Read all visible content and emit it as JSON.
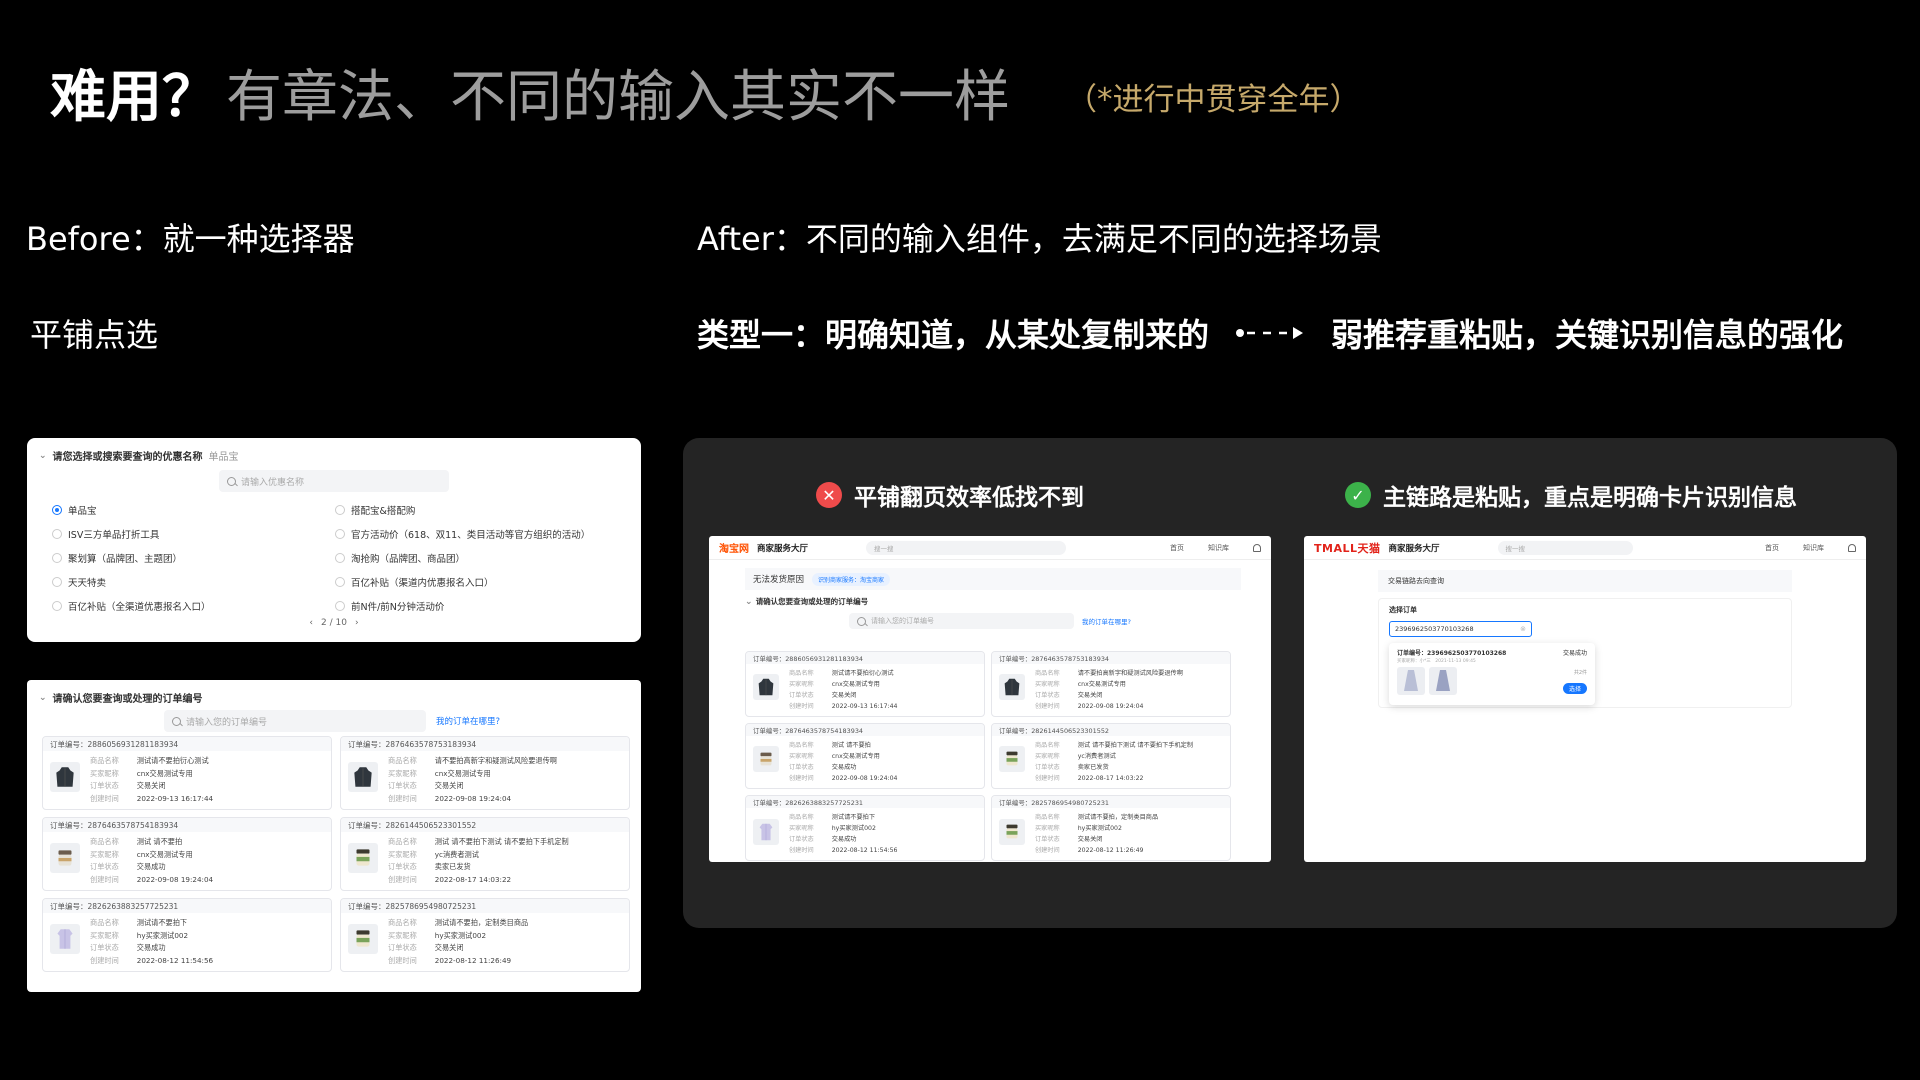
{
  "slide": {
    "title_strong": "难用？",
    "title_soft": "有章法、不同的输入其实不一样",
    "title_note": "（*进行中贯穿全年）",
    "before_heading": "Before：就一种选择器",
    "after_heading": "After：不同的输入组件，去满足不同的选择场景",
    "left_subheading": "平铺点选",
    "type_heading": "类型一：明确知道，从某处复制来的",
    "type_result": "弱推荐重粘贴，关键识别信息的强化"
  },
  "promo_panel": {
    "section_title": "请您选择或搜索要查询的优惠名称",
    "selected_value": "单品宝",
    "search_placeholder": "请输入优惠名称",
    "options": [
      {
        "label": "单品宝",
        "selected": true
      },
      {
        "label": "搭配宝&搭配购",
        "selected": false
      },
      {
        "label": "ISV三方单品打折工具",
        "selected": false
      },
      {
        "label": "官方活动价（618、双11、类目活动等官方组织的活动）",
        "selected": false
      },
      {
        "label": "聚划算（品牌团、主题团）",
        "selected": false
      },
      {
        "label": "淘抢购（品牌团、商品团）",
        "selected": false
      },
      {
        "label": "天天特卖",
        "selected": false
      },
      {
        "label": "百亿补贴（渠道内优惠报名入口）",
        "selected": false
      },
      {
        "label": "百亿补贴（全渠道优惠报名入口）",
        "selected": false
      },
      {
        "label": "前N件/前N分钟活动价",
        "selected": false
      }
    ],
    "pager": "2 / 10"
  },
  "order_panel": {
    "section_title": "请确认您要查询或处理的订单编号",
    "search_placeholder": "请输入您的订单编号",
    "help_link": "我的订单在哪里?",
    "field_labels": [
      "商品名称",
      "买家昵称",
      "订单状态",
      "创建时间"
    ],
    "orders": [
      {
        "id": "订单编号：2886056931281183934",
        "name": "测试请不要拍衍心测试",
        "buyer": "cnx交易测试专用",
        "status": "交易关闭",
        "time": "2022-09-13 16:17:44",
        "thumb": "jacket-dark"
      },
      {
        "id": "订单编号：2876463578753183934",
        "name": "请不要拍高新字和疑测试风险要退传啊",
        "buyer": "cnx交易测试专用",
        "status": "交易关闭",
        "time": "2022-09-08 19:24:04",
        "thumb": "jacket-dark"
      },
      {
        "id": "订单编号：2876463578754183934",
        "name": "测试 请不要拍",
        "buyer": "cnx交易测试专用",
        "status": "交易成功",
        "time": "2022-09-08 19:24:04",
        "thumb": "jar"
      },
      {
        "id": "订单编号：2826144506523301552",
        "name": "测试 请不要拍下测试 请不要拍下手机定制",
        "buyer": "yc消费者测试",
        "status": "卖家已发货",
        "time": "2022-08-17 14:03:22",
        "thumb": "jar-green"
      },
      {
        "id": "订单编号：2826263883257725231",
        "name": "测试请不要拍下",
        "buyer": "hy买家测试002",
        "status": "交易成功",
        "time": "2022-08-12 11:54:56",
        "thumb": "clothes-purple"
      },
      {
        "id": "订单编号：2825786954980725231",
        "name": "测试请不要拍，定制类目商品",
        "buyer": "hy买家测试002",
        "status": "交易关闭",
        "time": "2022-08-12 11:26:49",
        "thumb": "jar-green"
      }
    ]
  },
  "comparison": {
    "bad_label": "平铺翻页效率低找不到",
    "good_label": "主链路是粘贴，重点是明确卡片识别信息",
    "taobao": {
      "logo": "淘宝网",
      "hall": "商家服务大厅",
      "search_placeholder": "搜一搜",
      "nav": [
        "首页",
        "知识库"
      ],
      "scene_title": "无法发货原因",
      "scene_tag": "识别商家服务：淘宝商家",
      "section_title": "请确认您要查询或处理的订单编号",
      "search_placeholder_2": "请输入您的订单编号",
      "help_link": "我的订单在哪里?"
    },
    "tmall": {
      "logo": "TMALL天猫",
      "hall": "商家服务大厅",
      "search_placeholder": "搜一搜",
      "nav": [
        "首页",
        "知识库"
      ],
      "scene_title": "交易链路去向查询",
      "field_label": "选择订单",
      "input_value": "2396962503770103268",
      "card_id": "订单编号：2396962503770103268",
      "card_meta": "买家昵称：小*三　2021-11-13 09:45",
      "card_status": "交易成功",
      "card_count": "共2件",
      "card_button": "选择"
    }
  },
  "colors": {
    "background": "#000000",
    "title_soft": "#9d9d9d",
    "title_note": "#c6a96b",
    "dark_panel": "#242424",
    "bad": "#ef4b4b",
    "good": "#3cb24a",
    "accent_blue": "#1677ff"
  }
}
